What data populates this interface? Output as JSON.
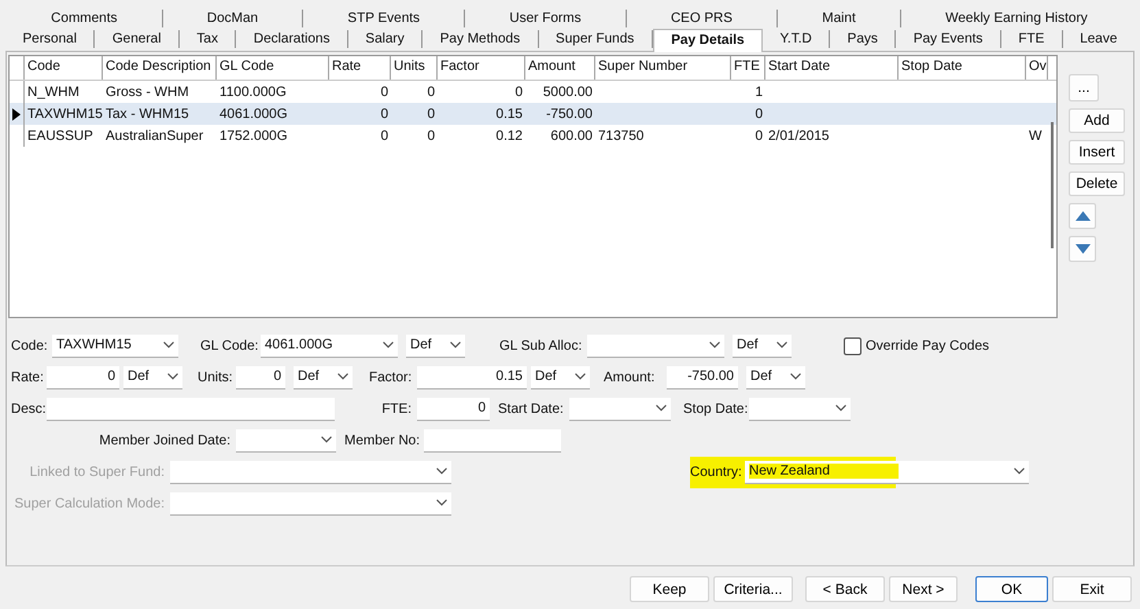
{
  "tabs_back": [
    {
      "label": "Comments",
      "selected": false
    },
    {
      "label": "DocMan",
      "selected": false
    },
    {
      "label": "STP Events",
      "selected": false
    },
    {
      "label": "User Forms",
      "selected": false
    },
    {
      "label": "CEO PRS",
      "selected": false
    },
    {
      "label": "Maint",
      "selected": false
    },
    {
      "label": "Weekly Earning History",
      "selected": false
    }
  ],
  "tabs_front": [
    {
      "label": "Personal",
      "selected": false
    },
    {
      "label": "General",
      "selected": false
    },
    {
      "label": "Tax",
      "selected": false
    },
    {
      "label": "Declarations",
      "selected": false
    },
    {
      "label": "Salary",
      "selected": false
    },
    {
      "label": "Pay Methods",
      "selected": false
    },
    {
      "label": "Super Funds",
      "selected": false
    },
    {
      "label": "Pay Details",
      "selected": true
    },
    {
      "label": "Y.T.D",
      "selected": false
    },
    {
      "label": "Pays",
      "selected": false
    },
    {
      "label": "Pay Events",
      "selected": false
    },
    {
      "label": "FTE",
      "selected": false
    },
    {
      "label": "Leave",
      "selected": false
    }
  ],
  "table": {
    "columns": [
      "Code",
      "Code Description",
      "GL Code",
      "Rate",
      "Units",
      "Factor",
      "Amount",
      "Super Number",
      "FTE",
      "Start Date",
      "Stop Date",
      "Ov"
    ],
    "rows": [
      {
        "selected": false,
        "cells": [
          "N_WHM",
          "Gross - WHM",
          "1100.000G",
          "0",
          "0",
          "0",
          "5000.00",
          "",
          "1",
          "",
          "",
          ""
        ]
      },
      {
        "selected": true,
        "cells": [
          "TAXWHM15",
          "Tax - WHM15",
          "4061.000G",
          "0",
          "0",
          "0.15",
          "-750.00",
          "",
          "0",
          "",
          "",
          ""
        ]
      },
      {
        "selected": false,
        "cells": [
          "EAUSSUP",
          "AustralianSuper",
          "1752.000G",
          "0",
          "0",
          "0.12",
          "600.00",
          "713750",
          "0",
          "2/01/2015",
          "",
          "W"
        ]
      }
    ]
  },
  "side_buttons": [
    {
      "kind": "text",
      "label": "..."
    },
    {
      "kind": "text",
      "label": "Add"
    },
    {
      "kind": "text",
      "label": "Insert"
    },
    {
      "kind": "text",
      "label": "Delete"
    },
    {
      "kind": "up"
    },
    {
      "kind": "down"
    }
  ],
  "form": {
    "code": {
      "label": "Code:",
      "value": "TAXWHM15"
    },
    "gl_code": {
      "label": "GL Code:",
      "value": "4061.000G",
      "mode": "Def"
    },
    "gl_sub_alloc": {
      "label": "GL Sub Alloc:",
      "mode": "Def"
    },
    "override": {
      "label": "Override Pay Codes",
      "checked": false
    },
    "rate": {
      "label": "Rate:",
      "value": "0",
      "mode": "Def"
    },
    "units": {
      "label": "Units:",
      "value": "0",
      "mode": "Def"
    },
    "factor": {
      "label": "Factor:",
      "value": "0.15",
      "mode": "Def"
    },
    "amount": {
      "label": "Amount:",
      "value": "-750.00",
      "mode": "Def"
    },
    "desc": {
      "label": "Desc:"
    },
    "fte": {
      "label": "FTE:",
      "value": "0"
    },
    "start_date": {
      "label": "Start Date:"
    },
    "stop_date": {
      "label": "Stop Date:"
    },
    "member_joined": {
      "label": "Member Joined Date:"
    },
    "member_no": {
      "label": "Member No:"
    },
    "linked_fund": {
      "label": "Linked to Super Fund:",
      "disabled": true
    },
    "calc_mode": {
      "label": "Super Calculation Mode:",
      "disabled": true
    },
    "country": {
      "label": "Country:",
      "value": "New Zealand",
      "highlighted": true
    }
  },
  "buttons": [
    {
      "label": "Keep",
      "default": false
    },
    {
      "label": "Criteria...",
      "default": false
    },
    {
      "label": "< Back",
      "default": false
    },
    {
      "label": "Next >",
      "default": false
    },
    {
      "label": "OK",
      "default": true
    },
    {
      "label": "Exit",
      "default": false
    }
  ]
}
